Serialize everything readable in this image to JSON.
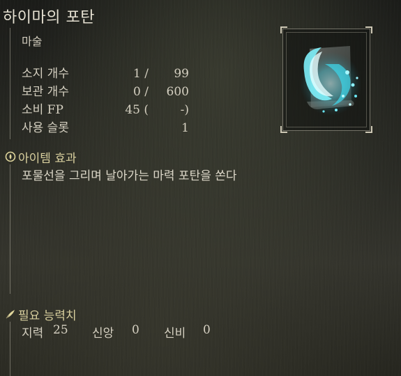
{
  "item": {
    "name": "하이마의 포탄",
    "category": "마술"
  },
  "stats": [
    {
      "label": "소지 개수",
      "v1": "1 /",
      "v2": "99"
    },
    {
      "label": "보관 개수",
      "v1": "0 /",
      "v2": "600"
    },
    {
      "label": "소비 FP",
      "v1": "45  (",
      "v2": "-)"
    },
    {
      "label": "사용 슬롯",
      "v1": "",
      "v2": "1"
    }
  ],
  "effect": {
    "header": "아이템 효과",
    "icon": "effect-emblem-icon",
    "text": "포물선을 그리며 날아가는 마력 포탄을 쏜다"
  },
  "requirements": {
    "header": "필요 능력치",
    "icon": "quill-icon",
    "items": [
      {
        "label": "지력",
        "value": "25"
      },
      {
        "label": "신앙",
        "value": "0"
      },
      {
        "label": "신비",
        "value": "0"
      }
    ]
  },
  "colors": {
    "accent": "#d8cf9e",
    "glow": "#5fe3f0"
  }
}
